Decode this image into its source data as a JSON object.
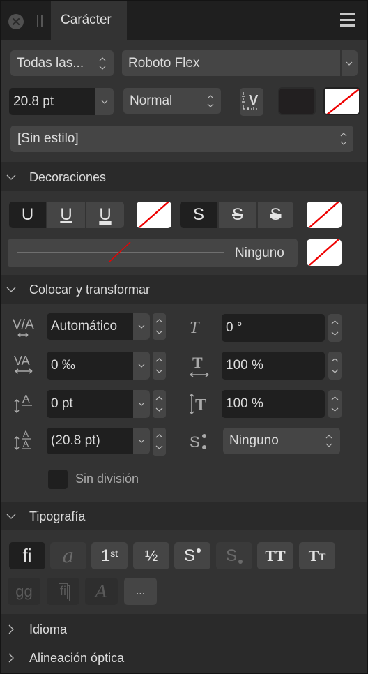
{
  "header": {
    "tab_label": "Carácter",
    "close_icon": "close-circle-icon",
    "grip_icon": "drag-handle-icon",
    "menu_icon": "hamburger-menu-icon"
  },
  "font": {
    "collection": "Todas las...",
    "family": "Roboto Flex",
    "size": "20.8 pt",
    "weight": "Normal",
    "style": "[Sin estilo]",
    "fill_color": "#221f20",
    "stroke_color": "none"
  },
  "decoraciones": {
    "title": "Decoraciones",
    "underline_options": [
      "U",
      "U",
      "U"
    ],
    "underline_selected": 0,
    "strike_options": [
      "S",
      "S",
      "S"
    ],
    "strike_selected": 0,
    "line_style_label": "Ninguno"
  },
  "colocar": {
    "title": "Colocar y transformar",
    "kerning": "Automático",
    "tracking": "0 ‰",
    "baseline": "0 pt",
    "leading": "(20.8 pt)",
    "shear": "0 °",
    "horizontal_scale": "100 %",
    "vertical_scale": "100 %",
    "position": "Ninguno",
    "no_break_label": "Sin división",
    "no_break_checked": false
  },
  "tipografia": {
    "title": "Tipografía",
    "buttons_row1": [
      {
        "glyph": "fi",
        "name": "ligatures",
        "state": "selected"
      },
      {
        "glyph": "a",
        "name": "swash",
        "state": "disabled"
      },
      {
        "glyph": "1",
        "sup": "st",
        "name": "ordinals",
        "state": "normal"
      },
      {
        "glyph": "½",
        "name": "fractions",
        "state": "normal"
      },
      {
        "glyph": "S",
        "name": "superscript",
        "state": "normal"
      },
      {
        "glyph": "S",
        "name": "subscript",
        "state": "disabled"
      },
      {
        "glyph": "TT",
        "name": "all-caps",
        "state": "normal"
      },
      {
        "glyph": "TT",
        "name": "small-caps",
        "state": "normal"
      }
    ],
    "buttons_row2": [
      {
        "glyph": "gg",
        "name": "stylistic-alternates",
        "state": "off"
      },
      {
        "glyph": "fi",
        "name": "discretionary-ligatures",
        "state": "off"
      },
      {
        "glyph": "A",
        "name": "calligraphic",
        "state": "off"
      },
      {
        "glyph": "...",
        "name": "more",
        "state": "normal"
      }
    ]
  },
  "collapsed_sections": [
    {
      "title": "Idioma"
    },
    {
      "title": "Alineación óptica"
    }
  ],
  "colors": {
    "accent_none": "#ff0000",
    "panel_bg": "#333333",
    "header_bg": "#2a2a2a"
  }
}
